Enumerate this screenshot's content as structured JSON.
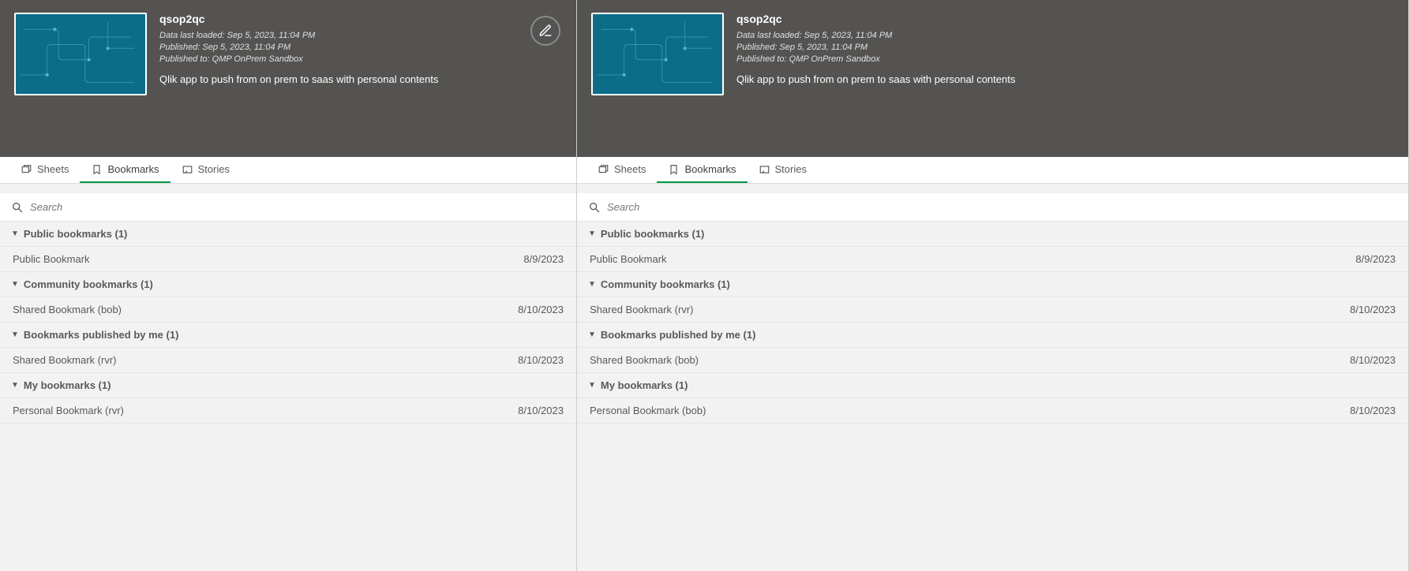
{
  "panels": [
    {
      "app": {
        "title": "qsop2qc",
        "loaded": "Data last loaded: Sep 5, 2023, 11:04 PM",
        "published": "Published: Sep 5, 2023, 11:04 PM",
        "publishedTo": "Published to: QMP OnPrem Sandbox",
        "desc": "Qlik app to push from on prem to saas with personal contents"
      },
      "showEdit": true,
      "tabs": {
        "sheets": "Sheets",
        "bookmarks": "Bookmarks",
        "stories": "Stories"
      },
      "search": {
        "placeholder": "Search"
      },
      "groups": [
        {
          "label": "Public bookmarks (1)",
          "items": [
            {
              "name": "Public Bookmark",
              "date": "8/9/2023"
            }
          ]
        },
        {
          "label": "Community bookmarks (1)",
          "items": [
            {
              "name": "Shared Bookmark (bob)",
              "date": "8/10/2023"
            }
          ]
        },
        {
          "label": "Bookmarks published by me (1)",
          "items": [
            {
              "name": "Shared Bookmark (rvr)",
              "date": "8/10/2023"
            }
          ]
        },
        {
          "label": "My bookmarks (1)",
          "items": [
            {
              "name": "Personal Bookmark (rvr)",
              "date": "8/10/2023"
            }
          ]
        }
      ]
    },
    {
      "app": {
        "title": "qsop2qc",
        "loaded": "Data last loaded: Sep 5, 2023, 11:04 PM",
        "published": "Published: Sep 5, 2023, 11:04 PM",
        "publishedTo": "Published to: QMP OnPrem Sandbox",
        "desc": "Qlik app to push from on prem to saas with personal contents"
      },
      "showEdit": false,
      "tabs": {
        "sheets": "Sheets",
        "bookmarks": "Bookmarks",
        "stories": "Stories"
      },
      "search": {
        "placeholder": "Search"
      },
      "groups": [
        {
          "label": "Public bookmarks (1)",
          "items": [
            {
              "name": "Public Bookmark",
              "date": "8/9/2023"
            }
          ]
        },
        {
          "label": "Community bookmarks (1)",
          "items": [
            {
              "name": "Shared Bookmark (rvr)",
              "date": "8/10/2023"
            }
          ]
        },
        {
          "label": "Bookmarks published by me (1)",
          "items": [
            {
              "name": "Shared Bookmark (bob)",
              "date": "8/10/2023"
            }
          ]
        },
        {
          "label": "My bookmarks (1)",
          "items": [
            {
              "name": "Personal Bookmark (bob)",
              "date": "8/10/2023"
            }
          ]
        }
      ]
    }
  ]
}
